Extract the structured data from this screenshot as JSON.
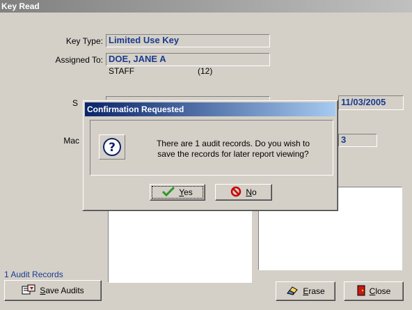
{
  "window": {
    "title": "Key Read"
  },
  "fields": {
    "key_type_label": "Key Type:",
    "key_type_value": "Limited Use Key",
    "assigned_to_label": "Assigned To:",
    "assigned_to_value": "DOE, JANE A",
    "role": "STAFF",
    "role_code": "(12)",
    "s_label": "S",
    "date_value": "11/03/2005",
    "mac_label": "Mac",
    "mac_value": "3"
  },
  "footer": {
    "audit_count": "1 Audit Records",
    "save_audits_label": "Save Audits",
    "save_audits_underline": "S",
    "erase_label": "Erase",
    "erase_underline": "E",
    "close_label": "Close",
    "close_underline": "C"
  },
  "dialog": {
    "title": "Confirmation Requested",
    "message_line1": "There are 1 audit records.  Do you wish to",
    "message_line2": "save the records for later report viewing?",
    "yes_label": "Yes",
    "yes_underline": "Y",
    "no_label": "No",
    "no_underline": "N"
  },
  "colors": {
    "accent": "#0a246a",
    "field_text": "#1a3a8f",
    "no_icon": "#cc0000",
    "yes_check": "#2a9a2a"
  }
}
